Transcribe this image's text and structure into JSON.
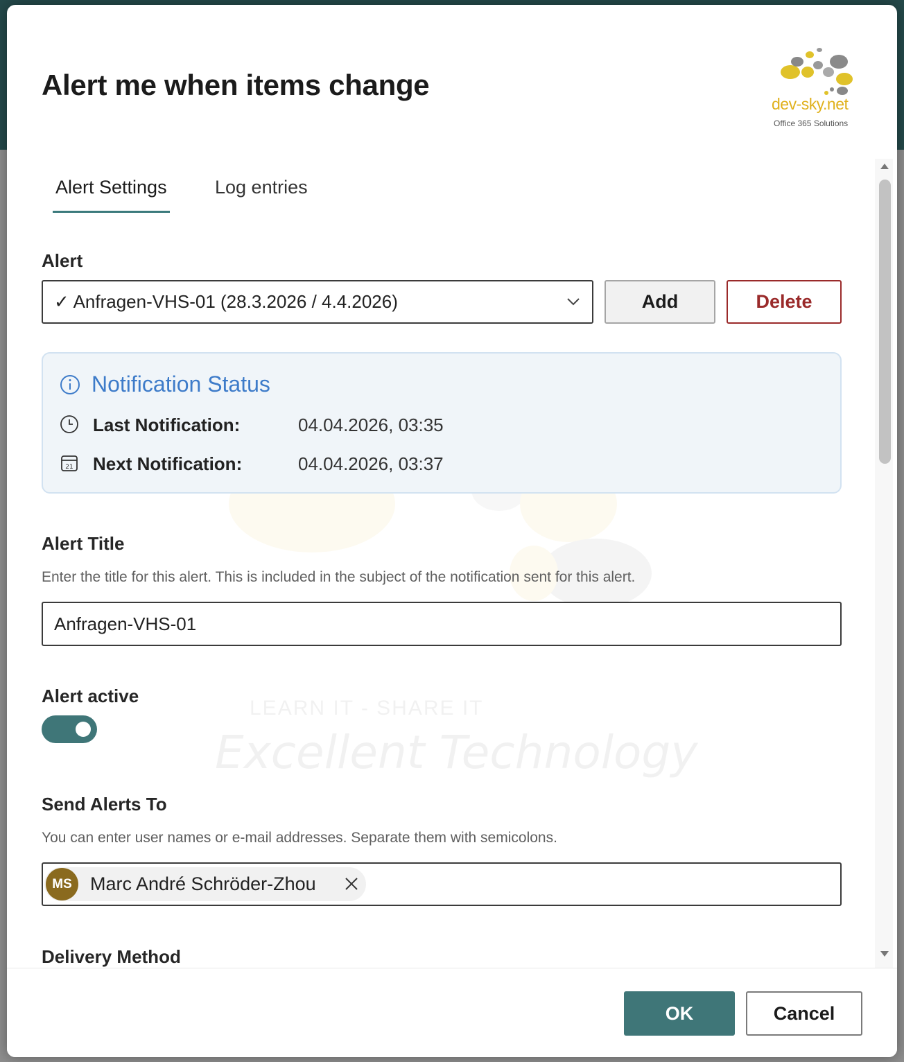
{
  "dialog": {
    "title": "Alert me when items change",
    "logo": {
      "text": "dev-sky.net",
      "subtitle": "Office 365 Solutions"
    },
    "watermark": {
      "tagline": "LEARN IT - SHARE IT",
      "slogan": "Excellent Technology"
    }
  },
  "tabs": [
    {
      "label": "Alert Settings",
      "active": true
    },
    {
      "label": "Log entries",
      "active": false
    }
  ],
  "alert": {
    "label": "Alert",
    "selected": "✓ Anfragen-VHS-01 (28.3.2026 / 4.4.2026)",
    "add_label": "Add",
    "delete_label": "Delete"
  },
  "notification_status": {
    "title": "Notification Status",
    "last_label": "Last Notification:",
    "last_value": "04.04.2026, 03:35",
    "next_label": "Next Notification:",
    "next_value": "04.04.2026, 03:37"
  },
  "alert_title": {
    "label": "Alert Title",
    "description": "Enter the title for this alert. This is included in the subject of the notification sent for this alert.",
    "value": "Anfragen-VHS-01"
  },
  "alert_active": {
    "label": "Alert active",
    "on": true
  },
  "send_alerts_to": {
    "label": "Send Alerts To",
    "description": "You can enter user names or e-mail addresses. Separate them with semicolons.",
    "people": [
      {
        "initials": "MS",
        "name": "Marc André Schröder-Zhou"
      }
    ]
  },
  "delivery_method": {
    "label": "Delivery Method"
  },
  "footer": {
    "ok_label": "OK",
    "cancel_label": "Cancel"
  },
  "colors": {
    "accent": "#3f7678",
    "danger": "#9a2a2a",
    "status_title": "#3d7bc9",
    "avatar": "#8a6a1e"
  }
}
